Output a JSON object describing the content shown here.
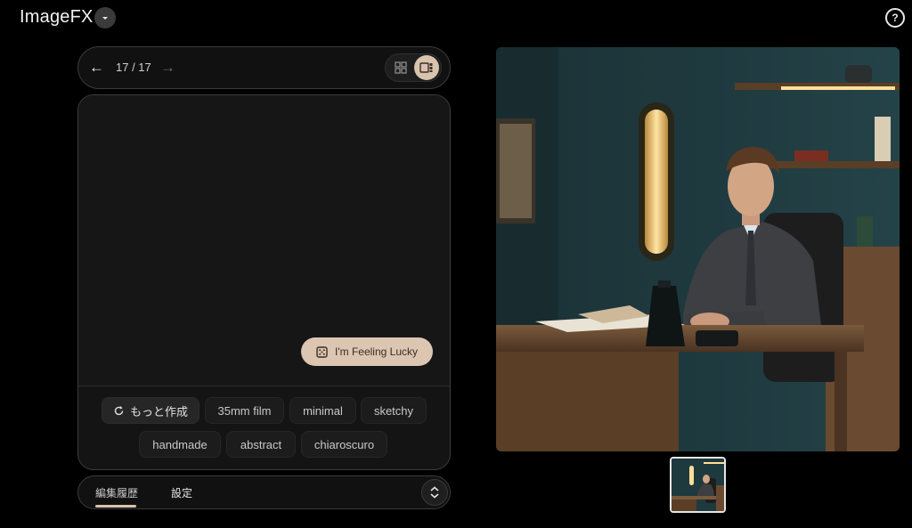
{
  "app": {
    "title": "ImageFX"
  },
  "icons": {
    "title_dropdown": "chevron-down-icon",
    "help": "question-circle-icon",
    "prev": "arrow-left-icon",
    "next": "arrow-right-icon",
    "grid_view": "grid-icon",
    "single_view": "single-image-view-icon",
    "lucky": "dice-icon",
    "more": "refresh-icon",
    "expand": "unfold-icon"
  },
  "help": {
    "label": "?"
  },
  "nav": {
    "prev": "←",
    "next": "→",
    "counter": "17 / 17"
  },
  "lucky": {
    "label": "I'm Feeling Lucky"
  },
  "chips": {
    "more": "もっと作成",
    "items": [
      "35mm film",
      "minimal",
      "sketchy",
      "handmade",
      "abstract",
      "chiaroscuro"
    ]
  },
  "tabs": {
    "history": "編集履歴",
    "settings": "設定"
  },
  "colors": {
    "accent": "#d8c3ae",
    "background": "#000000",
    "panel": "#141414",
    "border": "#3b3b3b"
  }
}
